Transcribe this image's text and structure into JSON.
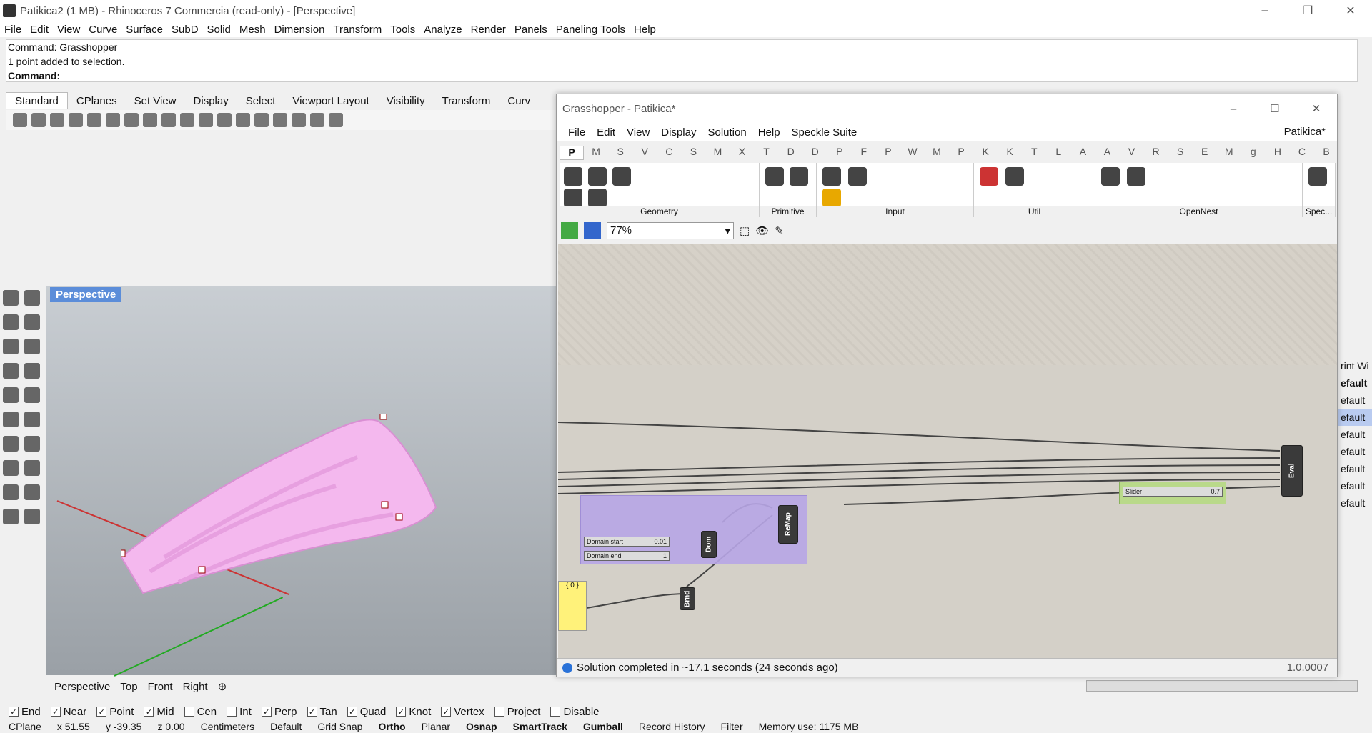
{
  "app": {
    "title": "Patikica2 (1 MB) - Rhinoceros 7 Commercia (read-only) - [Perspective]",
    "menu": [
      "File",
      "Edit",
      "View",
      "Curve",
      "Surface",
      "SubD",
      "Solid",
      "Mesh",
      "Dimension",
      "Transform",
      "Tools",
      "Analyze",
      "Render",
      "Panels",
      "Paneling Tools",
      "Help"
    ],
    "window_buttons": [
      "–",
      "❐",
      "✕"
    ]
  },
  "command": {
    "history1": "Command: Grasshopper",
    "history2": "1 point added to selection.",
    "prompt": "Command:"
  },
  "toolbar_tabs": [
    "Standard",
    "CPlanes",
    "Set View",
    "Display",
    "Select",
    "Viewport Layout",
    "Visibility",
    "Transform",
    "Curv"
  ],
  "viewport": {
    "label": "Perspective",
    "tabs": [
      "Perspective",
      "Top",
      "Front",
      "Right"
    ],
    "add_tab": "⊕"
  },
  "osnap": [
    {
      "label": "End",
      "checked": true
    },
    {
      "label": "Near",
      "checked": true
    },
    {
      "label": "Point",
      "checked": true
    },
    {
      "label": "Mid",
      "checked": true
    },
    {
      "label": "Cen",
      "checked": false
    },
    {
      "label": "Int",
      "checked": false
    },
    {
      "label": "Perp",
      "checked": true
    },
    {
      "label": "Tan",
      "checked": true
    },
    {
      "label": "Quad",
      "checked": true
    },
    {
      "label": "Knot",
      "checked": true
    },
    {
      "label": "Vertex",
      "checked": true
    },
    {
      "label": "Project",
      "checked": false
    },
    {
      "label": "Disable",
      "checked": false
    }
  ],
  "statusbar": {
    "cplane": "CPlane",
    "x": "x 51.55",
    "y": "y -39.35",
    "z": "z 0.00",
    "units": "Centimeters",
    "layer": "Default",
    "grid_snap": "Grid Snap",
    "ortho": "Ortho",
    "planar": "Planar",
    "osnap": "Osnap",
    "smarttrack": "SmartTrack",
    "gumball": "Gumball",
    "record_history": "Record History",
    "filter": "Filter",
    "memory": "Memory use: 1175 MB"
  },
  "grasshopper": {
    "title": "Grasshopper - Patikica*",
    "doc_name": "Patikica*",
    "menu": [
      "File",
      "Edit",
      "View",
      "Display",
      "Solution",
      "Help",
      "Speckle Suite"
    ],
    "tab_letters": [
      "P",
      "M",
      "S",
      "V",
      "C",
      "S",
      "M",
      "X",
      "T",
      "D",
      "D",
      "P",
      "F",
      "P",
      "W",
      "M",
      "P",
      "K",
      "K",
      "T",
      "L",
      "A",
      "A",
      "V",
      "R",
      "S",
      "E",
      "M",
      "g",
      "H",
      "C",
      "B"
    ],
    "groups": [
      "Geometry",
      "Primitive",
      "Input",
      "Util",
      "OpenNest",
      "Spec..."
    ],
    "zoom": "77%",
    "status": "Solution completed in ~17.1 seconds (24 seconds ago)",
    "version": "1.0.0007",
    "components": {
      "domain_start": "Domain start",
      "domain_start_val": "0.01",
      "domain_end": "Domain end",
      "domain_end_val": "1",
      "dom": "Dom",
      "remap": "ReMap",
      "eval": "Eval",
      "brnd": "Brnd",
      "slider": "Slider",
      "slider_val": "0.7",
      "panel": "{ 0 }"
    }
  },
  "right_panel": [
    "rint Wi",
    "efault",
    "efault",
    "efault",
    "efault",
    "efault",
    "efault",
    "efault",
    "efault"
  ]
}
